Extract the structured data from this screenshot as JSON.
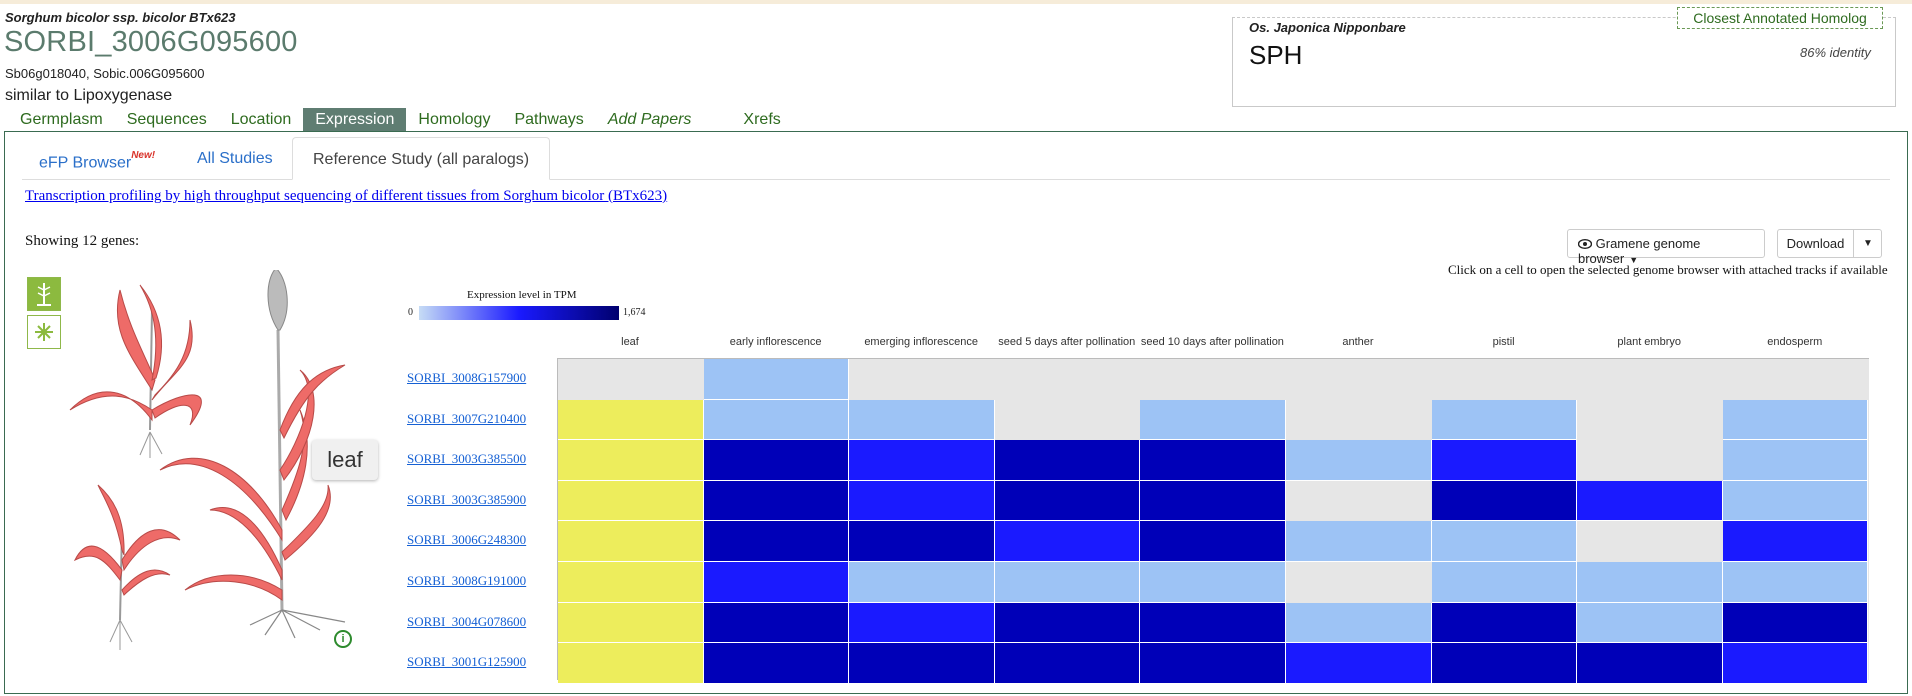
{
  "header": {
    "species": "Sorghum bicolor ssp. bicolor BTx623",
    "gene_id": "SORBI_3006G095600",
    "synonyms": "Sb06g018040, Sobic.006G095600",
    "description": "similar to Lipoxygenase"
  },
  "homolog": {
    "button_label": "Closest Annotated Homolog",
    "species": "Os. Japonica Nipponbare",
    "name": "SPH",
    "identity": "86% identity"
  },
  "nav_tabs": [
    "Germplasm",
    "Sequences",
    "Location",
    "Expression",
    "Homology",
    "Pathways",
    "Add Papers",
    "Xrefs"
  ],
  "active_nav_tab": "Expression",
  "sub_tabs": {
    "efp": "eFP Browser",
    "efp_badge": "New!",
    "all_studies": "All Studies",
    "reference": "Reference Study (all paralogs)"
  },
  "study_link": "Transcription profiling by high throughput sequencing of different tissues from Sorghum bicolor (BTx623)",
  "showing": "Showing 12 genes:",
  "toolbar": {
    "browser_label": "Gramene genome browser",
    "download_label": "Download",
    "hint": "Click on a cell to open the selected genome browser with attached tracks if available"
  },
  "efp": {
    "tooltip": "leaf"
  },
  "legend": {
    "title": "Expression level in TPM",
    "min": "0",
    "max": "1,674"
  },
  "colors": {
    "none": "#e6e6e6",
    "light": "#9dc3f5",
    "medium": "#1a1aff",
    "dark": "#0000b8",
    "selected": "#eded5c"
  },
  "heatmap": {
    "columns": [
      "leaf",
      "early inflorescence",
      "emerging inflorescence",
      "seed 5 days after pollination",
      "seed 10 days after pollination",
      "anther",
      "pistil",
      "plant embryo",
      "endosperm"
    ],
    "rows": [
      {
        "gene": "SORBI_3008G157900",
        "levels": [
          "none",
          "light",
          "none",
          "none",
          "none",
          "none",
          "none",
          "none",
          "none"
        ]
      },
      {
        "gene": "SORBI_3007G210400",
        "levels": [
          "selected",
          "light",
          "light",
          "none",
          "light",
          "none",
          "light",
          "none",
          "light"
        ]
      },
      {
        "gene": "SORBI_3003G385500",
        "levels": [
          "selected",
          "dark",
          "medium",
          "dark",
          "dark",
          "light",
          "medium",
          "none",
          "light"
        ]
      },
      {
        "gene": "SORBI_3003G385900",
        "levels": [
          "selected",
          "dark",
          "medium",
          "dark",
          "dark",
          "none",
          "dark",
          "medium",
          "light"
        ]
      },
      {
        "gene": "SORBI_3006G248300",
        "levels": [
          "selected",
          "dark",
          "dark",
          "medium",
          "dark",
          "light",
          "light",
          "none",
          "medium"
        ]
      },
      {
        "gene": "SORBI_3008G191000",
        "levels": [
          "selected",
          "medium",
          "light",
          "light",
          "light",
          "none",
          "light",
          "light",
          "light"
        ]
      },
      {
        "gene": "SORBI_3004G078600",
        "levels": [
          "selected",
          "dark",
          "medium",
          "dark",
          "dark",
          "light",
          "dark",
          "light",
          "dark"
        ]
      },
      {
        "gene": "SORBI_3001G125900",
        "levels": [
          "selected",
          "dark",
          "dark",
          "dark",
          "dark",
          "medium",
          "dark",
          "dark",
          "medium"
        ]
      }
    ]
  }
}
